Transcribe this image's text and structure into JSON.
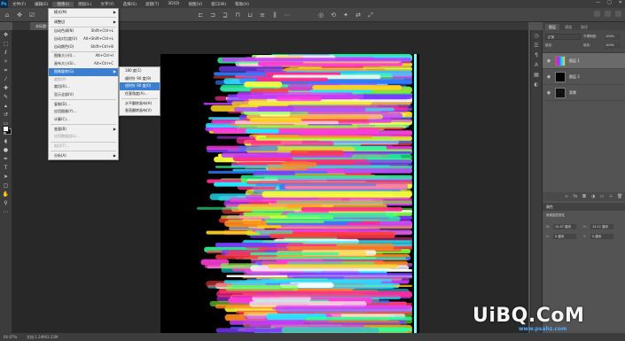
{
  "app": {
    "logo": "Ps"
  },
  "menubar": {
    "items": [
      "文件(F)",
      "编辑(E)",
      "图像(I)",
      "图层(L)",
      "文字(Y)",
      "选择(S)",
      "滤镜(T)",
      "3D(D)",
      "视图(V)",
      "窗口(W)",
      "帮助(H)"
    ],
    "active_index": 2,
    "window_controls": [
      "—",
      "□",
      "✕"
    ]
  },
  "document": {
    "tab_label": "未标题-1 @ 66.7%(图层 1, RGB/8)"
  },
  "status": {
    "zoom": "66.67%",
    "info": "文档:1.24M/3.22M"
  },
  "image_menu": {
    "items": [
      {
        "label": "模式(M)",
        "shortcut": "",
        "submenu": true,
        "disabled": false
      },
      {
        "separator": true
      },
      {
        "label": "调整(J)",
        "shortcut": "",
        "submenu": true,
        "disabled": false
      },
      {
        "separator": true
      },
      {
        "label": "自动色调(N)",
        "shortcut": "Shift+Ctrl+L",
        "submenu": false,
        "disabled": false
      },
      {
        "label": "自动对比度(U)",
        "shortcut": "Alt+Shift+Ctrl+L",
        "submenu": false,
        "disabled": false
      },
      {
        "label": "自动颜色(O)",
        "shortcut": "Shift+Ctrl+B",
        "submenu": false,
        "disabled": false
      },
      {
        "separator": true
      },
      {
        "label": "图像大小(I)...",
        "shortcut": "Alt+Ctrl+I",
        "submenu": false,
        "disabled": false
      },
      {
        "label": "画布大小(S)...",
        "shortcut": "Alt+Ctrl+C",
        "submenu": false,
        "disabled": false
      },
      {
        "label": "图像旋转(G)",
        "shortcut": "",
        "submenu": true,
        "disabled": false,
        "highlight": true
      },
      {
        "label": "裁剪(P)",
        "shortcut": "",
        "submenu": false,
        "disabled": true
      },
      {
        "label": "裁切(R)...",
        "shortcut": "",
        "submenu": false,
        "disabled": false
      },
      {
        "label": "显示全部(V)",
        "shortcut": "",
        "submenu": false,
        "disabled": false
      },
      {
        "separator": true
      },
      {
        "label": "复制(D)...",
        "shortcut": "",
        "submenu": false,
        "disabled": false
      },
      {
        "label": "应用图像(Y)...",
        "shortcut": "",
        "submenu": false,
        "disabled": false
      },
      {
        "label": "计算(C)...",
        "shortcut": "",
        "submenu": false,
        "disabled": false
      },
      {
        "separator": true
      },
      {
        "label": "变量(B)",
        "shortcut": "",
        "submenu": true,
        "disabled": false
      },
      {
        "label": "应用数据组(L)...",
        "shortcut": "",
        "submenu": false,
        "disabled": true
      },
      {
        "separator": true
      },
      {
        "label": "陷印(T)...",
        "shortcut": "",
        "submenu": false,
        "disabled": true
      },
      {
        "separator": true
      },
      {
        "label": "分析(A)",
        "shortcut": "",
        "submenu": true,
        "disabled": false
      }
    ]
  },
  "rotate_menu": {
    "items": [
      {
        "label": "180 度(1)",
        "highlight": false
      },
      {
        "label": "顺时针 90 度(9)",
        "highlight": false
      },
      {
        "label": "逆时针 90 度(0)",
        "highlight": true
      },
      {
        "label": "任意角度(A)...",
        "highlight": false
      },
      {
        "separator": true
      },
      {
        "label": "水平翻转画布(H)",
        "highlight": false
      },
      {
        "label": "垂直翻转画布(V)",
        "highlight": false
      }
    ]
  },
  "layers_panel": {
    "tabs": [
      "图层",
      "通道",
      "路径"
    ],
    "blend_mode": "正常",
    "opacity_label": "不透明度:",
    "opacity": "100%",
    "lock_label": "锁定:",
    "fill_label": "填充:",
    "fill": "100%",
    "layers": [
      {
        "name": "图层 1",
        "thumb": "color",
        "selected": true
      },
      {
        "name": "图层 2",
        "thumb": "black",
        "selected": false
      },
      {
        "name": "背景",
        "thumb": "dark",
        "selected": false
      }
    ]
  },
  "properties_panel": {
    "title": "属性",
    "subtitle": "像素图层属性",
    "w_label": "W:",
    "w_value": "14.07 厘米",
    "h_label": "H:",
    "h_value": "14.11 厘米",
    "x_label": "X:",
    "x_value": "0 厘米",
    "y_label": "Y:",
    "y_value": "0 厘米"
  },
  "watermark": {
    "main": "UiBQ.CoM",
    "sub": "www.psahz.com"
  },
  "colors": {
    "accent": "#3c7fd0",
    "ui_dark": "#3c3c3c",
    "canvas_bg": "#282828",
    "cyan_bar": "#7fffff"
  }
}
